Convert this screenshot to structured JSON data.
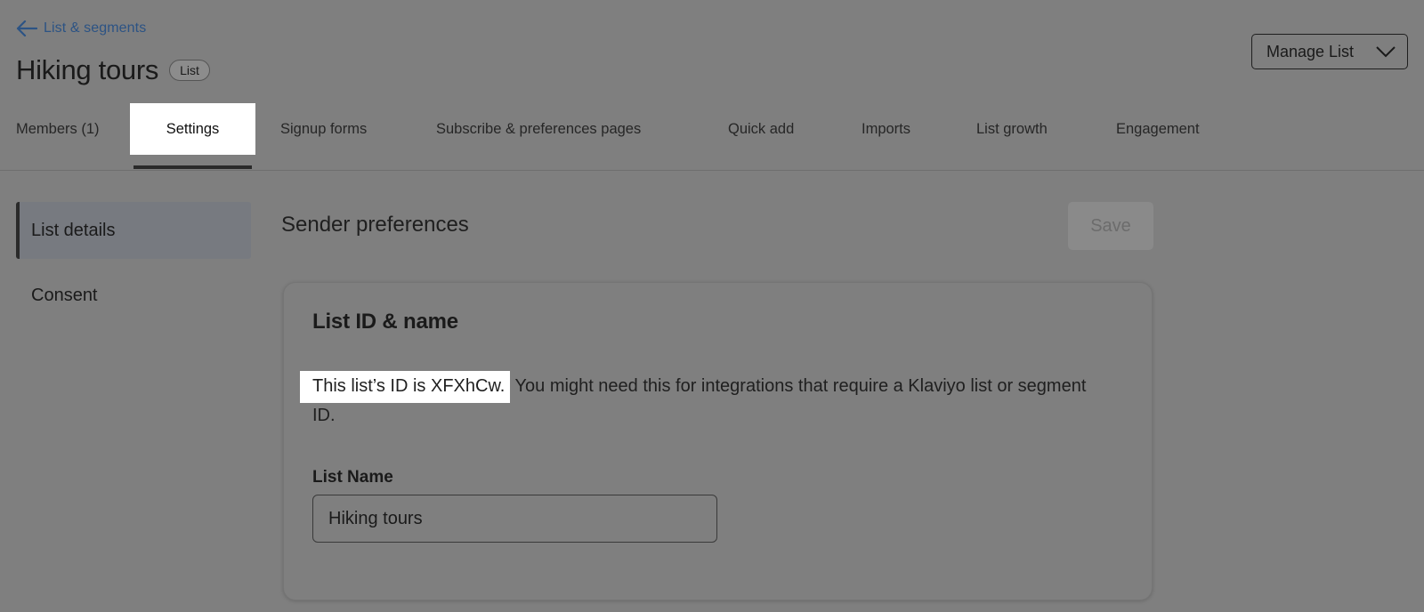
{
  "header": {
    "back_label": "List & segments",
    "title": "Hiking tours",
    "badge": "List",
    "manage_button": "Manage List"
  },
  "tabs": [
    {
      "label": "Members (1)",
      "active": false
    },
    {
      "label": "Settings",
      "active": true
    },
    {
      "label": "Signup forms",
      "active": false
    },
    {
      "label": "Subscribe & preferences pages",
      "active": false
    },
    {
      "label": "Quick add",
      "active": false
    },
    {
      "label": "Imports",
      "active": false
    },
    {
      "label": "List growth",
      "active": false
    },
    {
      "label": "Engagement",
      "active": false
    }
  ],
  "sidenav": {
    "items": [
      {
        "label": "List details",
        "active": true
      },
      {
        "label": "Consent",
        "active": false
      }
    ]
  },
  "main": {
    "section_title": "Sender preferences",
    "save_label": "Save",
    "card": {
      "title": "List ID & name",
      "desc_highlight": "This list’s ID is XFXhCw.",
      "desc_rest": " You might need this for integrations that require a Klaviyo list or segment ID.",
      "field_label": "List Name",
      "field_value": "Hiking tours"
    }
  },
  "colors": {
    "overlay_gray": "#7f7f7f",
    "link_blue": "#2c5384",
    "highlight": "#ffffff"
  }
}
